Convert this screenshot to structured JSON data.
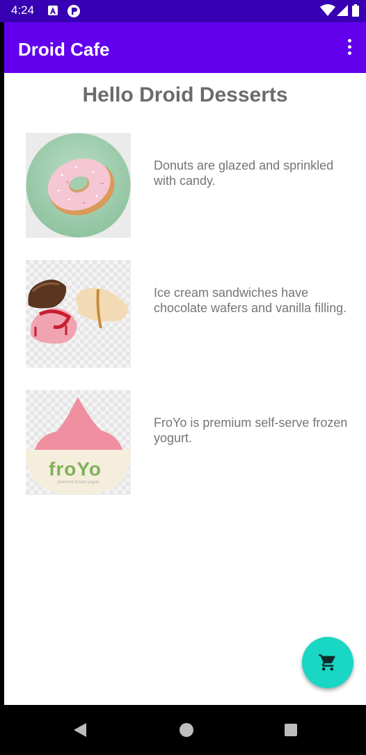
{
  "status_bar": {
    "time": "4:24",
    "icons": [
      "a-notification-icon",
      "app-notification-icon",
      "wifi-icon",
      "signal-icon",
      "battery-icon"
    ]
  },
  "app_bar": {
    "title": "Droid Cafe",
    "overflow_icon": "more-vert-icon"
  },
  "main": {
    "heading": "Hello Droid Desserts",
    "items": [
      {
        "image": "donut-image",
        "description": "Donuts are glazed and sprinkled with candy."
      },
      {
        "image": "ice-cream-sandwich-image",
        "description": "Ice cream sandwiches have chocolate wafers and vanilla filling."
      },
      {
        "image": "froyo-image",
        "description": "FroYo is premium self-serve frozen yogurt."
      }
    ],
    "froyo_logo_text": "froYo",
    "froyo_tagline": "premium frozen yogurt"
  },
  "fab": {
    "icon": "shopping-cart-icon"
  },
  "nav_bar": {
    "icons": [
      "back-icon",
      "home-icon",
      "recents-icon"
    ]
  },
  "colors": {
    "status_bar": "#3700b3",
    "app_bar": "#6200ee",
    "fab": "#1ad6c4",
    "heading_text": "#6b6b6b",
    "body_text": "#757575"
  }
}
